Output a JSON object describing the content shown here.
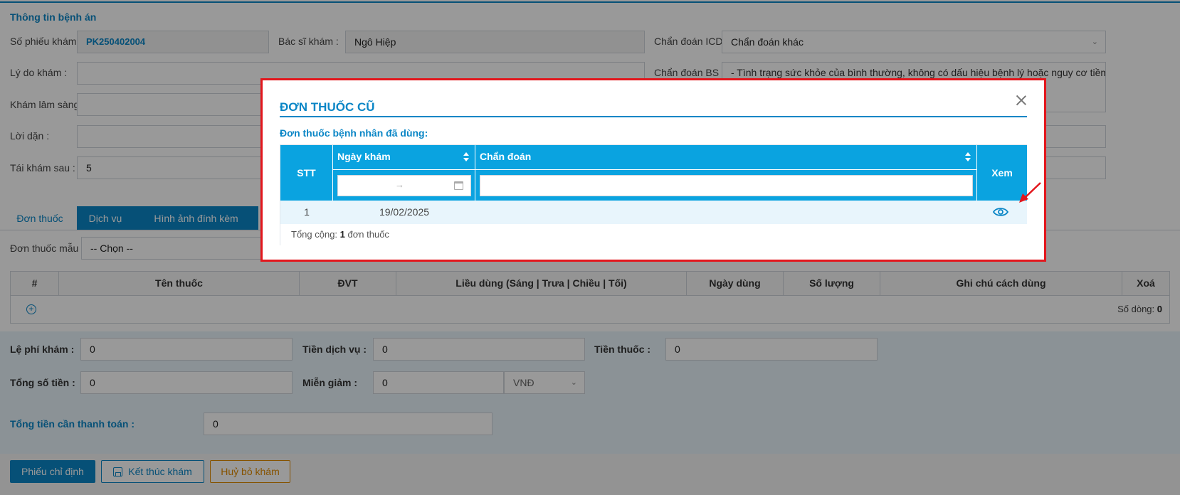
{
  "form": {
    "section_title": "Thông tin bệnh án",
    "so_phieu_kham": {
      "label": "Số phiếu khám :",
      "value": "PK250402004"
    },
    "bac_si_kham": {
      "label": "Bác sĩ khám :",
      "value": "Ngô Hiệp"
    },
    "chan_doan_icd": {
      "label": "Chẩn đoán ICD :",
      "value": "Chẩn đoán khác"
    },
    "ly_do_kham": {
      "label": "Lý do khám :",
      "value": ""
    },
    "chan_doan_bs": {
      "label": "Chẩn đoán BS :",
      "value": "- Tình trạng sức khỏe của bình thường, không có dấu hiệu bệnh lý hoặc nguy cơ tiềm ẩn."
    },
    "kham_lam_sang": {
      "label": "Khám lâm sàng :",
      "value": ""
    },
    "loi_dan": {
      "label": "Lời dặn :",
      "value": ""
    },
    "tai_kham_sau": {
      "label": "Tái khám sau :",
      "value": "5"
    }
  },
  "tabs": [
    {
      "label": "Đơn thuốc",
      "active": true
    },
    {
      "label": "Dịch vụ",
      "active": false
    },
    {
      "label": "Hình ảnh đính kèm",
      "active": false
    }
  ],
  "prescription": {
    "template_label": "Đơn thuốc mẫu :",
    "template_value": "-- Chọn --",
    "columns": [
      "#",
      "Tên thuốc",
      "ĐVT",
      "Liều dùng (Sáng | Trưa | Chiều | Tối)",
      "Ngày dùng",
      "Số lượng",
      "Ghi chú cách dùng",
      "Xoá"
    ],
    "row_count_label": "Số dòng:",
    "row_count": "0"
  },
  "payment": {
    "le_phi_kham": {
      "label": "Lệ phí khám :",
      "value": "0"
    },
    "tien_dich_vu": {
      "label": "Tiền dịch vụ :",
      "value": "0"
    },
    "tien_thuoc": {
      "label": "Tiền thuốc :",
      "value": "0"
    },
    "tong_so_tien": {
      "label": "Tổng số tiền :",
      "value": "0"
    },
    "mien_giam": {
      "label": "Miễn giảm :",
      "value": "0",
      "currency": "VNĐ"
    },
    "tong_tien_can_thanh_toan": {
      "label": "Tổng tiền cần thanh toán :",
      "value": "0"
    }
  },
  "actions": {
    "phieu_chi_dinh": "Phiếu chỉ định",
    "ket_thuc_kham": "Kết thúc khám",
    "huy_bo_kham": "Huỷ bỏ khám"
  },
  "modal": {
    "title": "ĐƠN THUỐC CŨ",
    "subtitle": "Đơn thuốc bệnh nhân đã dùng:",
    "columns": {
      "stt": "STT",
      "ngay_kham": "Ngày khám",
      "chan_doan": "Chẩn đoán",
      "xem": "Xem"
    },
    "date_range_separator": "→",
    "rows": [
      {
        "stt": "1",
        "ngay_kham": "19/02/2025",
        "chan_doan": ""
      }
    ],
    "footer": {
      "prefix": "Tổng cộng:",
      "count": "1",
      "suffix": "đơn thuốc"
    }
  },
  "colors": {
    "accent": "#0a86c6",
    "header": "#0aa3e0",
    "highlight_border": "#e3161c",
    "warn": "#e08a00"
  }
}
